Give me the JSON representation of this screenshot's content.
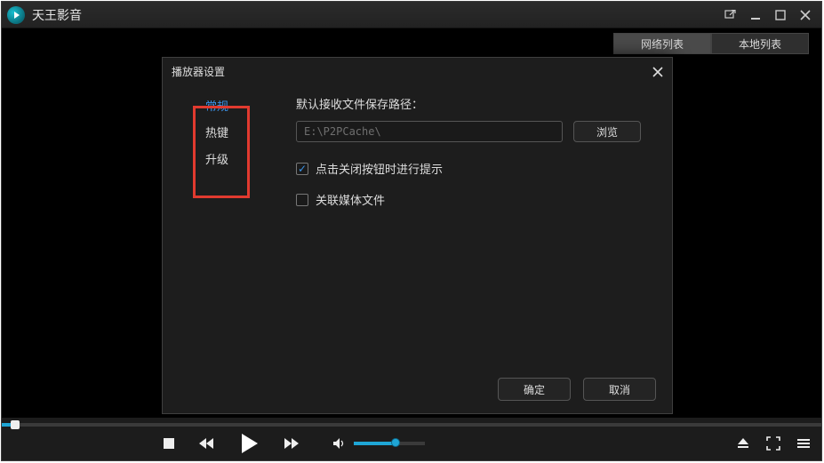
{
  "app": {
    "title": "天王影音"
  },
  "toptabs": {
    "network": "网络列表",
    "local": "本地列表"
  },
  "settings": {
    "title": "播放器设置",
    "sidebar": {
      "general": "常规",
      "hotkeys": "热键",
      "upgrade": "升级"
    },
    "content": {
      "default_path_label": "默认接收文件保存路径：",
      "path_value": "E:\\P2PCache\\",
      "browse": "浏览",
      "check_close_prompt": "点击关闭按钮时进行提示",
      "check_associate": "关联媒体文件"
    },
    "buttons": {
      "ok": "确定",
      "cancel": "取消"
    }
  },
  "icons": {
    "popout": "popout-icon",
    "minimize": "minimize-icon",
    "maximize": "maximize-icon",
    "close": "close-icon"
  }
}
